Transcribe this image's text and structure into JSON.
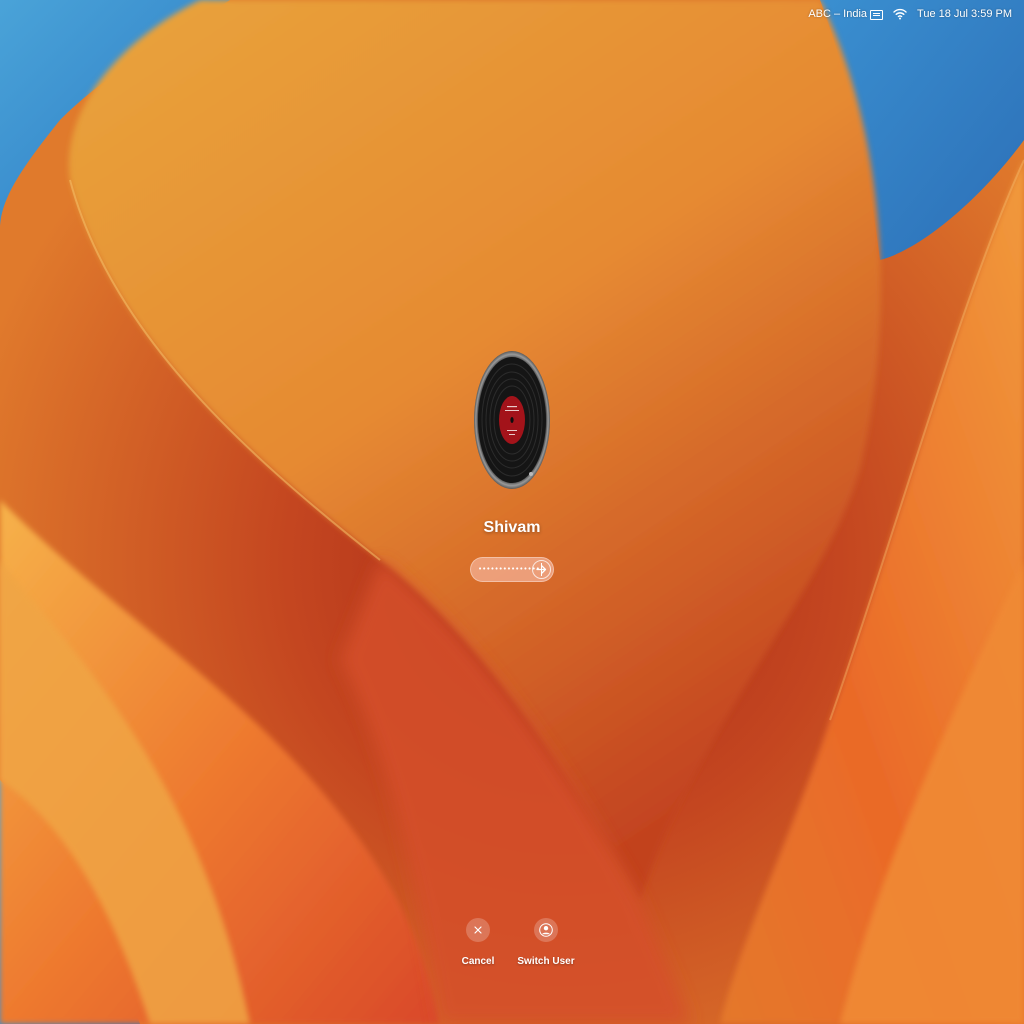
{
  "menubar": {
    "input_source": "ABC – India",
    "datetime": "Tue 18 Jul  3:59 PM",
    "icons": [
      "keyboard-icon",
      "wifi-icon"
    ]
  },
  "login": {
    "username": "Shivam",
    "password_masked": "•••••••••••••••",
    "submit_icon": "arrow-right-icon"
  },
  "actions": {
    "cancel_label": "Cancel",
    "switch_user_label": "Switch User"
  },
  "colors": {
    "wallpaper_orange": "#e8832c",
    "wallpaper_deep": "#b8361d",
    "wallpaper_blue": "#3a8fd0"
  }
}
